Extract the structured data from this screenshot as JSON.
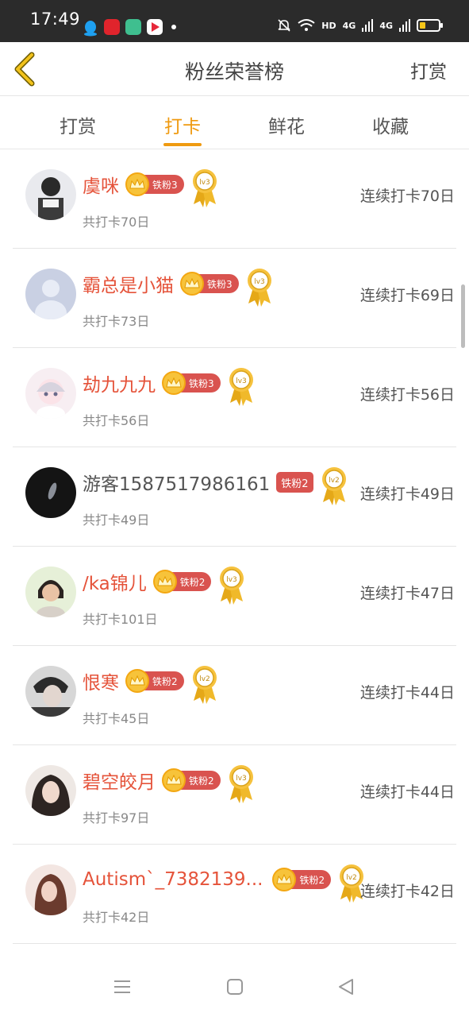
{
  "status": {
    "time": "17:49",
    "network": "HD",
    "signal1": "4G",
    "signal2": "4G"
  },
  "header": {
    "title": "粉丝荣誉榜",
    "action": "打赏"
  },
  "tabs": [
    {
      "label": "打赏",
      "active": false
    },
    {
      "label": "打卡",
      "active": true
    },
    {
      "label": "鲜花",
      "active": false
    },
    {
      "label": "收藏",
      "active": false
    }
  ],
  "rows": [
    {
      "name": "虞咪",
      "fan": "铁粉3",
      "level": "lv3",
      "total": "共打卡70日",
      "streak": "连续打卡70日"
    },
    {
      "name": "霸总是小猫",
      "fan": "铁粉3",
      "level": "lv3",
      "total": "共打卡73日",
      "streak": "连续打卡69日"
    },
    {
      "name": "劫九九九",
      "fan": "铁粉3",
      "level": "lv3",
      "total": "共打卡56日",
      "streak": "连续打卡56日"
    },
    {
      "name": "游客1587517986161",
      "fan": "铁粉2",
      "level": "lv2",
      "total": "共打卡49日",
      "streak": "连续打卡49日"
    },
    {
      "name": "/ka锦儿",
      "fan": "铁粉2",
      "level": "lv3",
      "total": "共打卡101日",
      "streak": "连续打卡47日"
    },
    {
      "name": "恨寒",
      "fan": "铁粉2",
      "level": "lv2",
      "total": "共打卡45日",
      "streak": "连续打卡44日"
    },
    {
      "name": "碧空皎月",
      "fan": "铁粉2",
      "level": "lv3",
      "total": "共打卡97日",
      "streak": "连续打卡44日"
    },
    {
      "name": "Autism`_7382139...",
      "fan": "铁粉2",
      "level": "lv2",
      "total": "共打卡42日",
      "streak": "连续打卡42日"
    }
  ],
  "colors": {
    "accent": "#ef9a10",
    "name_red": "#e5533a",
    "fan_badge": "#d9534f",
    "crown_gold": "#f7c33a"
  }
}
